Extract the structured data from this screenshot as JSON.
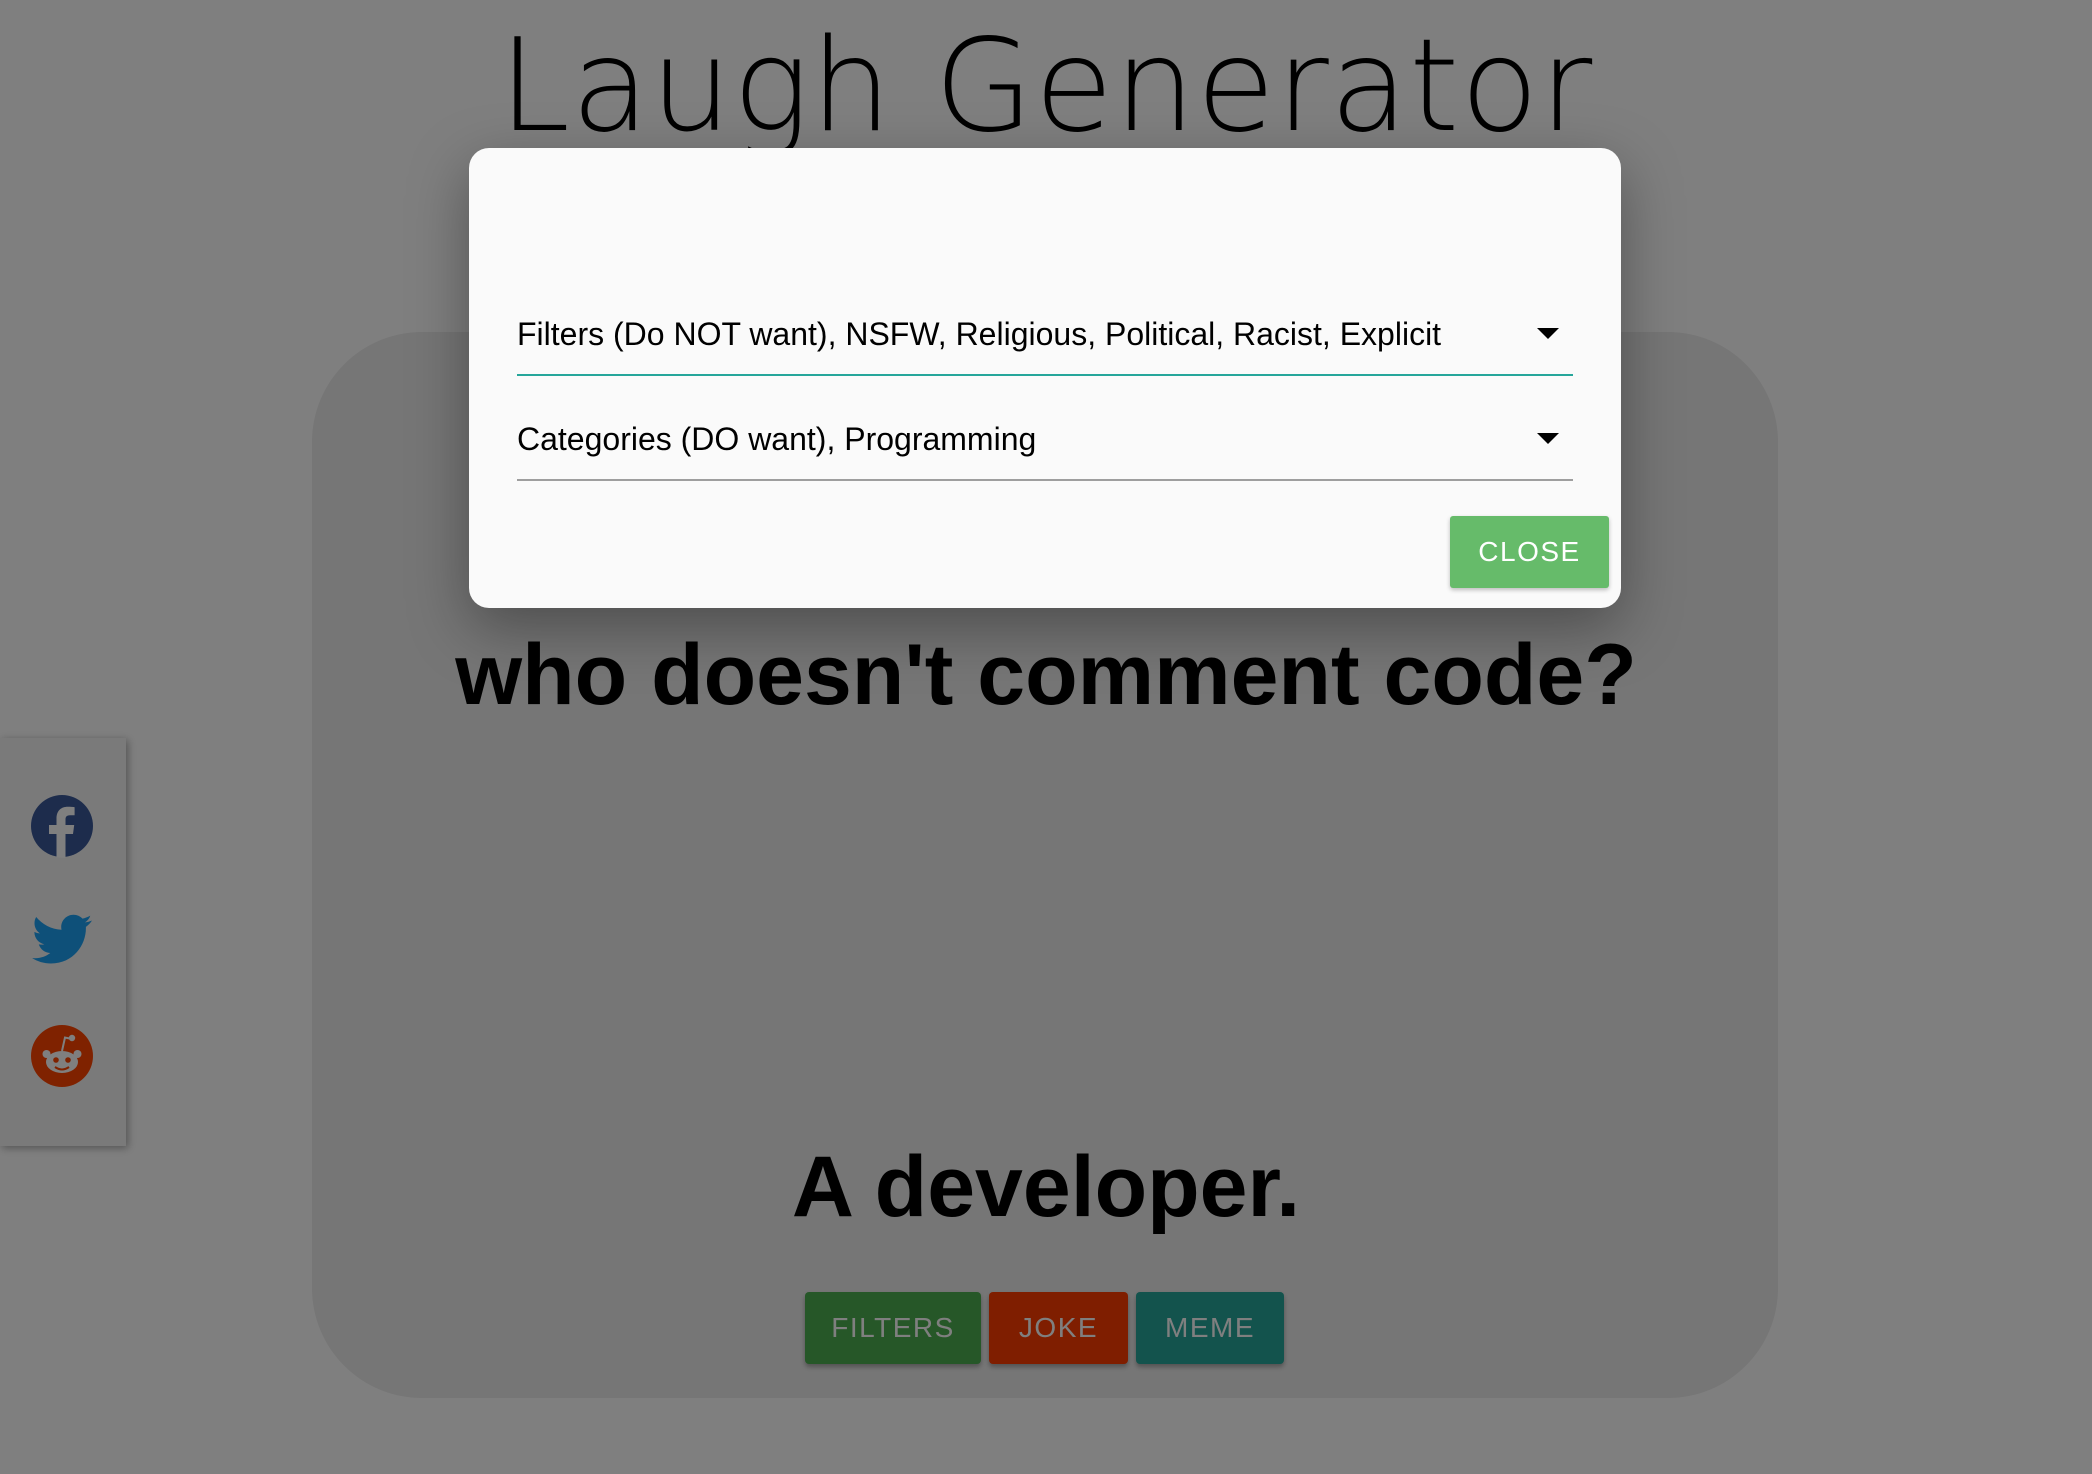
{
  "app": {
    "title": "Laugh Generator"
  },
  "joke": {
    "setup": "who doesn't comment code?",
    "punchline": "A developer."
  },
  "actions": {
    "filters_label": "FILTERS",
    "joke_label": "JOKE",
    "meme_label": "MEME"
  },
  "share": {
    "icons": [
      "facebook-icon",
      "twitter-icon",
      "reddit-icon"
    ]
  },
  "modal": {
    "filters_value": "Filters (Do NOT want), NSFW, Religious, Political, Racist, Explicit",
    "categories_value": "Categories (DO want), Programming",
    "close_label": "CLOSE"
  },
  "colors": {
    "filters_button": "#4caf50",
    "joke_button": "#ff3d00",
    "meme_button": "#26a69a",
    "close_button": "#66bb6a",
    "active_underline": "#26a69a",
    "facebook": "#3b5998",
    "twitter": "#1da1f2",
    "reddit": "#ff4500"
  }
}
